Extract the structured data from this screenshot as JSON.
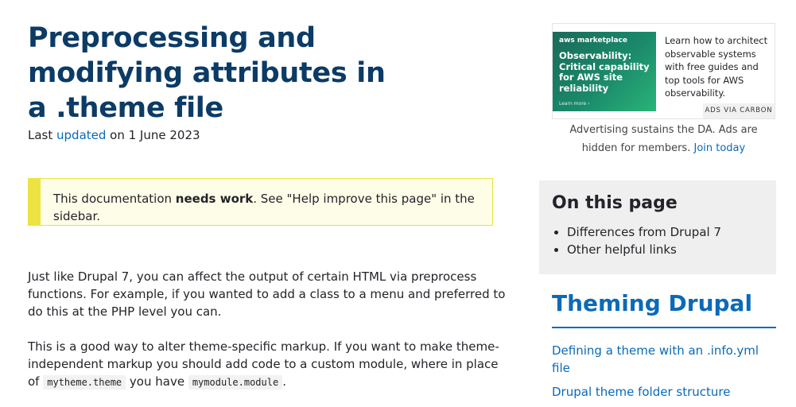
{
  "article": {
    "title": "Preprocessing and modifying attributes in a .theme file",
    "updated_prefix": "Last ",
    "updated_link": "updated",
    "updated_suffix": " on 1 June 2023"
  },
  "notice": {
    "prefix": "This documentation ",
    "bold": "needs work",
    "suffix": ". See \"Help improve this page\" in the sidebar."
  },
  "body": {
    "p1": "Just like Drupal 7, you can affect the output of certain HTML via preprocess functions. For example, if you wanted to add a class to a menu and preferred to do this at the PHP level you can.",
    "p2_text1": "This is a good way to alter theme-specific markup. If you want to make theme-independent markup you should add code to a custom module, where in place of ",
    "p2_code1": "mytheme.theme",
    "p2_text2": " you have ",
    "p2_code2": "mymodule.module",
    "p2_text3": "."
  },
  "ad": {
    "brand": "aws marketplace",
    "headline": "Observability: Critical capability for AWS site reliability",
    "more": "Learn more ›",
    "text": "Learn how to architect observable systems with free guides and top tools for AWS observability.",
    "via": "ADS VIA CARBON",
    "note": "Advertising sustains the DA. Ads are hidden for members.",
    "join": "Join today"
  },
  "toc": {
    "title": "On this page",
    "items": [
      "Differences from Drupal 7",
      "Other helpful links"
    ]
  },
  "guide": {
    "title": "Theming Drupal",
    "links": [
      "Defining a theme with an .info.yml file",
      "Drupal theme folder structure"
    ]
  },
  "colors": {
    "title": "#0b3b66",
    "link": "#0a6ab8",
    "notice_border": "#ece341",
    "notice_bg": "#fefde8"
  }
}
